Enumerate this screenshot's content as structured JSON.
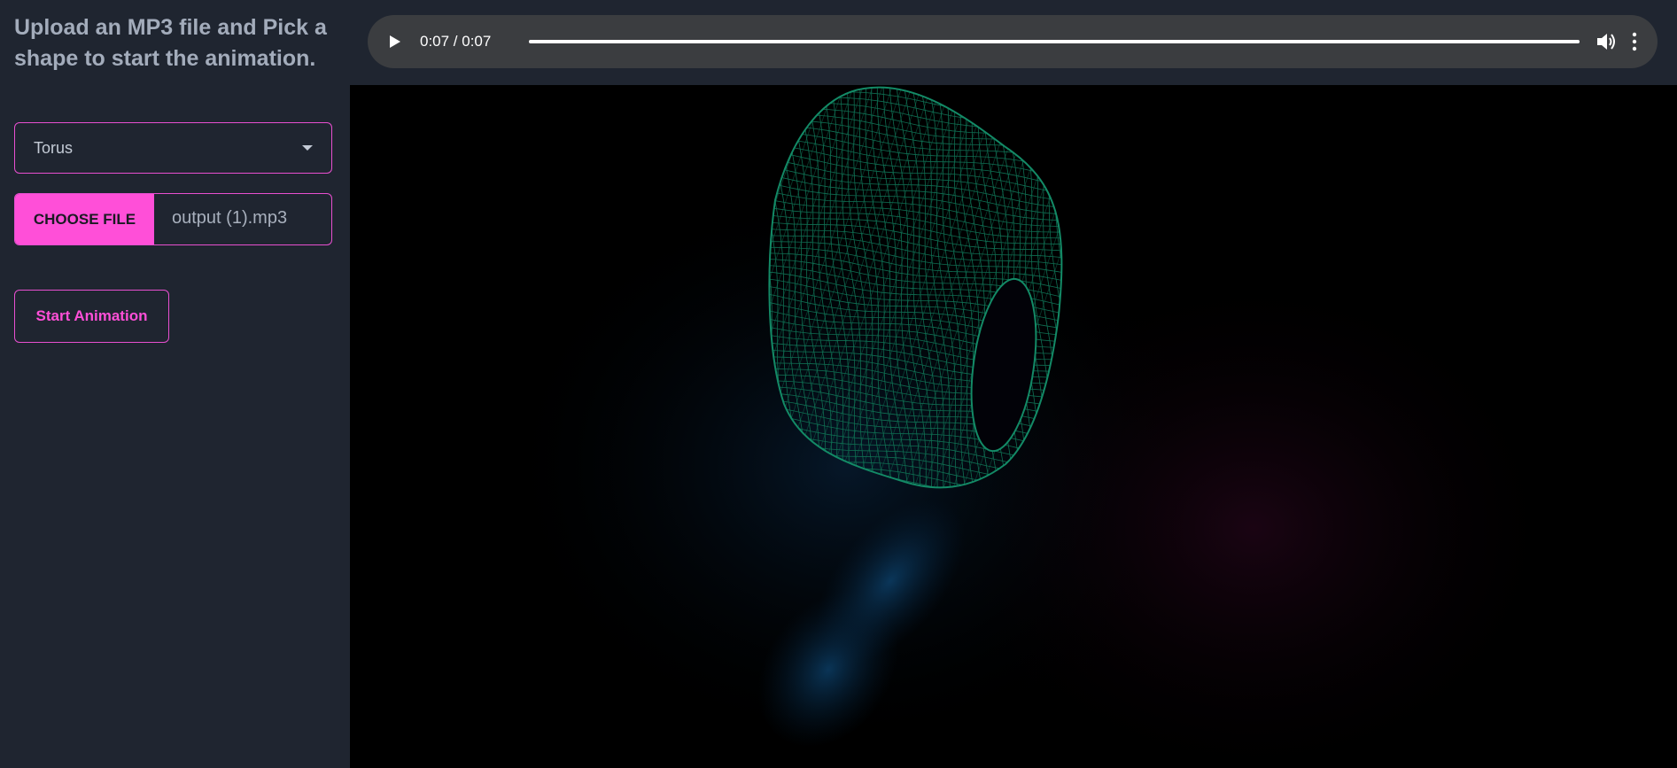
{
  "sidebar": {
    "title": "Upload an MP3 file and Pick a shape to start the animation.",
    "shape_select": {
      "value": "Torus",
      "icon": "chevron-down-icon"
    },
    "file_picker": {
      "button_label": "CHOOSE FILE",
      "file_name": "output (1).mp3"
    },
    "start_button_label": "Start Animation"
  },
  "audio_player": {
    "time": "0:07 / 0:07",
    "progress": 1.0,
    "icons": [
      "play-icon",
      "volume-icon",
      "more-icon"
    ]
  },
  "visualizer": {
    "shape": "torus wireframe",
    "colors": {
      "mesh": "#0f6e52",
      "glow_blue": "#0b3a66",
      "glow_pink": "#3a0a2a"
    }
  },
  "theme": {
    "accent": "#ff4fd8",
    "panel": "#1f2530",
    "player": "#3b3d40"
  }
}
